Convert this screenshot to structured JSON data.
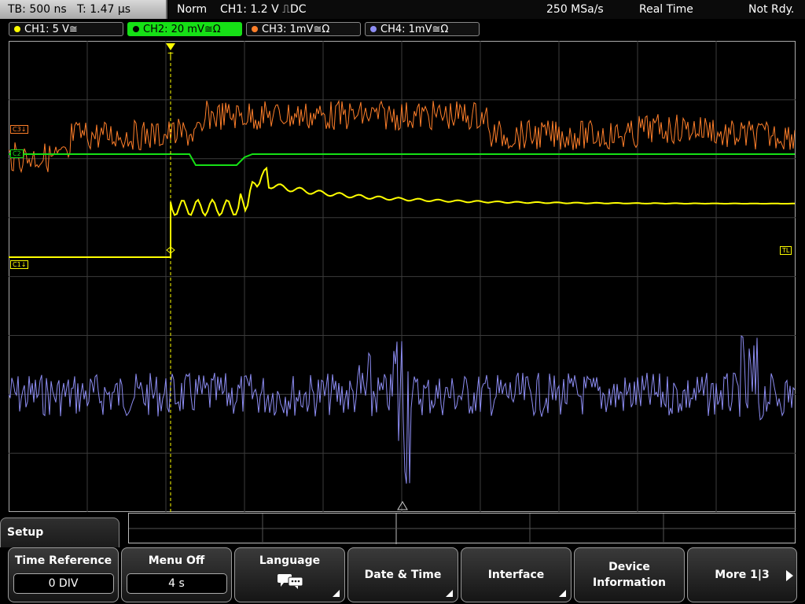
{
  "status": {
    "timebase": "TB: 500 ns",
    "trigger_time": "T: 1.47 µs",
    "mode": "Norm",
    "trigger": "CH1: 1.2 V",
    "trigger_coupling": "DC",
    "sample_rate": "250 MSa/s",
    "acq_mode": "Real Time",
    "state": "Not Rdy."
  },
  "channels": [
    {
      "label": "CH1: 5 V≅",
      "color": "#ffff00"
    },
    {
      "label": "CH2: 20 mV≅Ω",
      "color": "#16e016"
    },
    {
      "label": "CH3: 1mV≅Ω",
      "color": "#ff7f2a"
    },
    {
      "label": "CH4: 1mV≅Ω",
      "color": "#8e8ef5"
    }
  ],
  "markers": {
    "c3": "C3",
    "c2": "C2",
    "c1": "C1",
    "tl": "TL",
    "trigger": "T"
  },
  "menu": {
    "title": "Setup",
    "keys": [
      {
        "label": "Time Reference",
        "value": "0 DIV"
      },
      {
        "label": "Menu Off",
        "value": "4 s"
      },
      {
        "label": "Language",
        "icon": "speech-bubbles-icon"
      },
      {
        "label": "Date & Time"
      },
      {
        "label": "Interface"
      },
      {
        "label": "Device",
        "label2": "Information"
      },
      {
        "label": "More 1|3"
      }
    ]
  }
}
